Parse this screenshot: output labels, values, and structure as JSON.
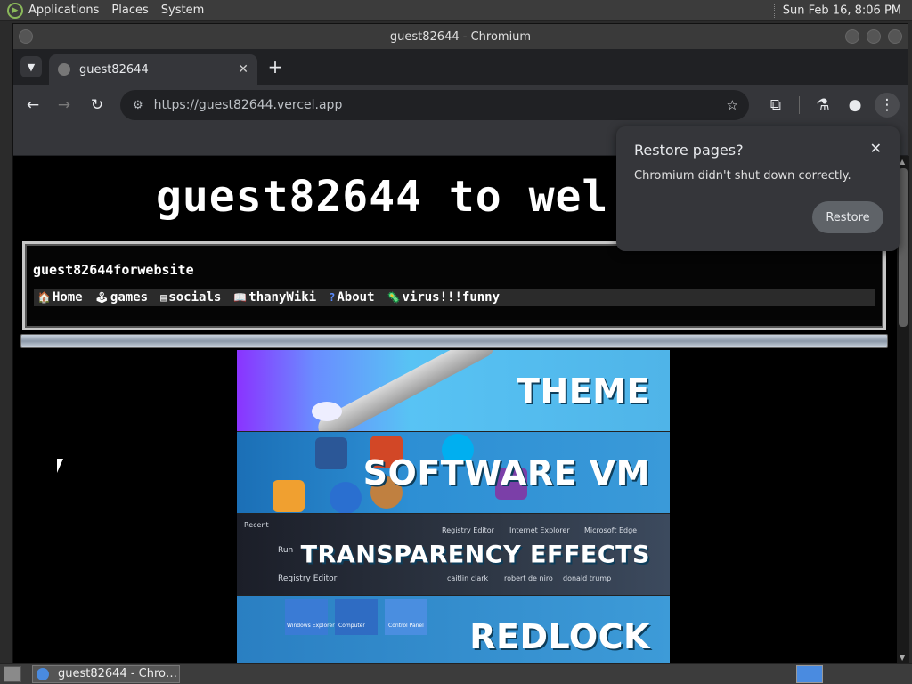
{
  "top_panel": {
    "menus": [
      "Applications",
      "Places",
      "System"
    ],
    "clock": "Sun Feb 16,  8:06 PM"
  },
  "window": {
    "title": "guest82644 - Chromium"
  },
  "browser": {
    "tab_title": "guest82644",
    "tab_close": "✕",
    "new_tab": "+",
    "url": "https://guest82644.vercel.app",
    "back": "←",
    "forward": "→",
    "reload": "↻",
    "star": "☆",
    "extensions": "⧉",
    "labs": "⚗",
    "profile": "●",
    "menu": "⋮"
  },
  "page": {
    "site_title": "guest82644 to wel",
    "nav_title": "guest82644forwebsite",
    "nav_links": [
      {
        "icon": "🏠",
        "label": "Home"
      },
      {
        "icon": "🕹",
        "label": "games"
      },
      {
        "icon": "▤",
        "label": "socials"
      },
      {
        "icon": "📖",
        "label": "thanyWiki"
      },
      {
        "icon": "?",
        "label": "About"
      },
      {
        "icon": "🦠",
        "label": "virus!!!funny"
      }
    ],
    "banners": [
      {
        "label": "THEME"
      },
      {
        "label": "SOFTWARE VM"
      },
      {
        "label": "TRANSPARENCY EFFECTS",
        "small_texts": [
          "Recent",
          "Run",
          "Registry Editor",
          "Registry Editor",
          "Internet Explorer",
          "Microsoft Edge",
          "caitlin clark",
          "robert de niro",
          "donald trump"
        ]
      },
      {
        "label": "REDLOCK",
        "small_texts": [
          "Windows Explorer",
          "Computer",
          "Control Panel"
        ]
      }
    ]
  },
  "popup": {
    "title": "Restore pages?",
    "message": "Chromium didn't shut down correctly.",
    "button": "Restore",
    "close": "✕"
  },
  "taskbar": {
    "task_label": "guest82644 - Chro…"
  }
}
